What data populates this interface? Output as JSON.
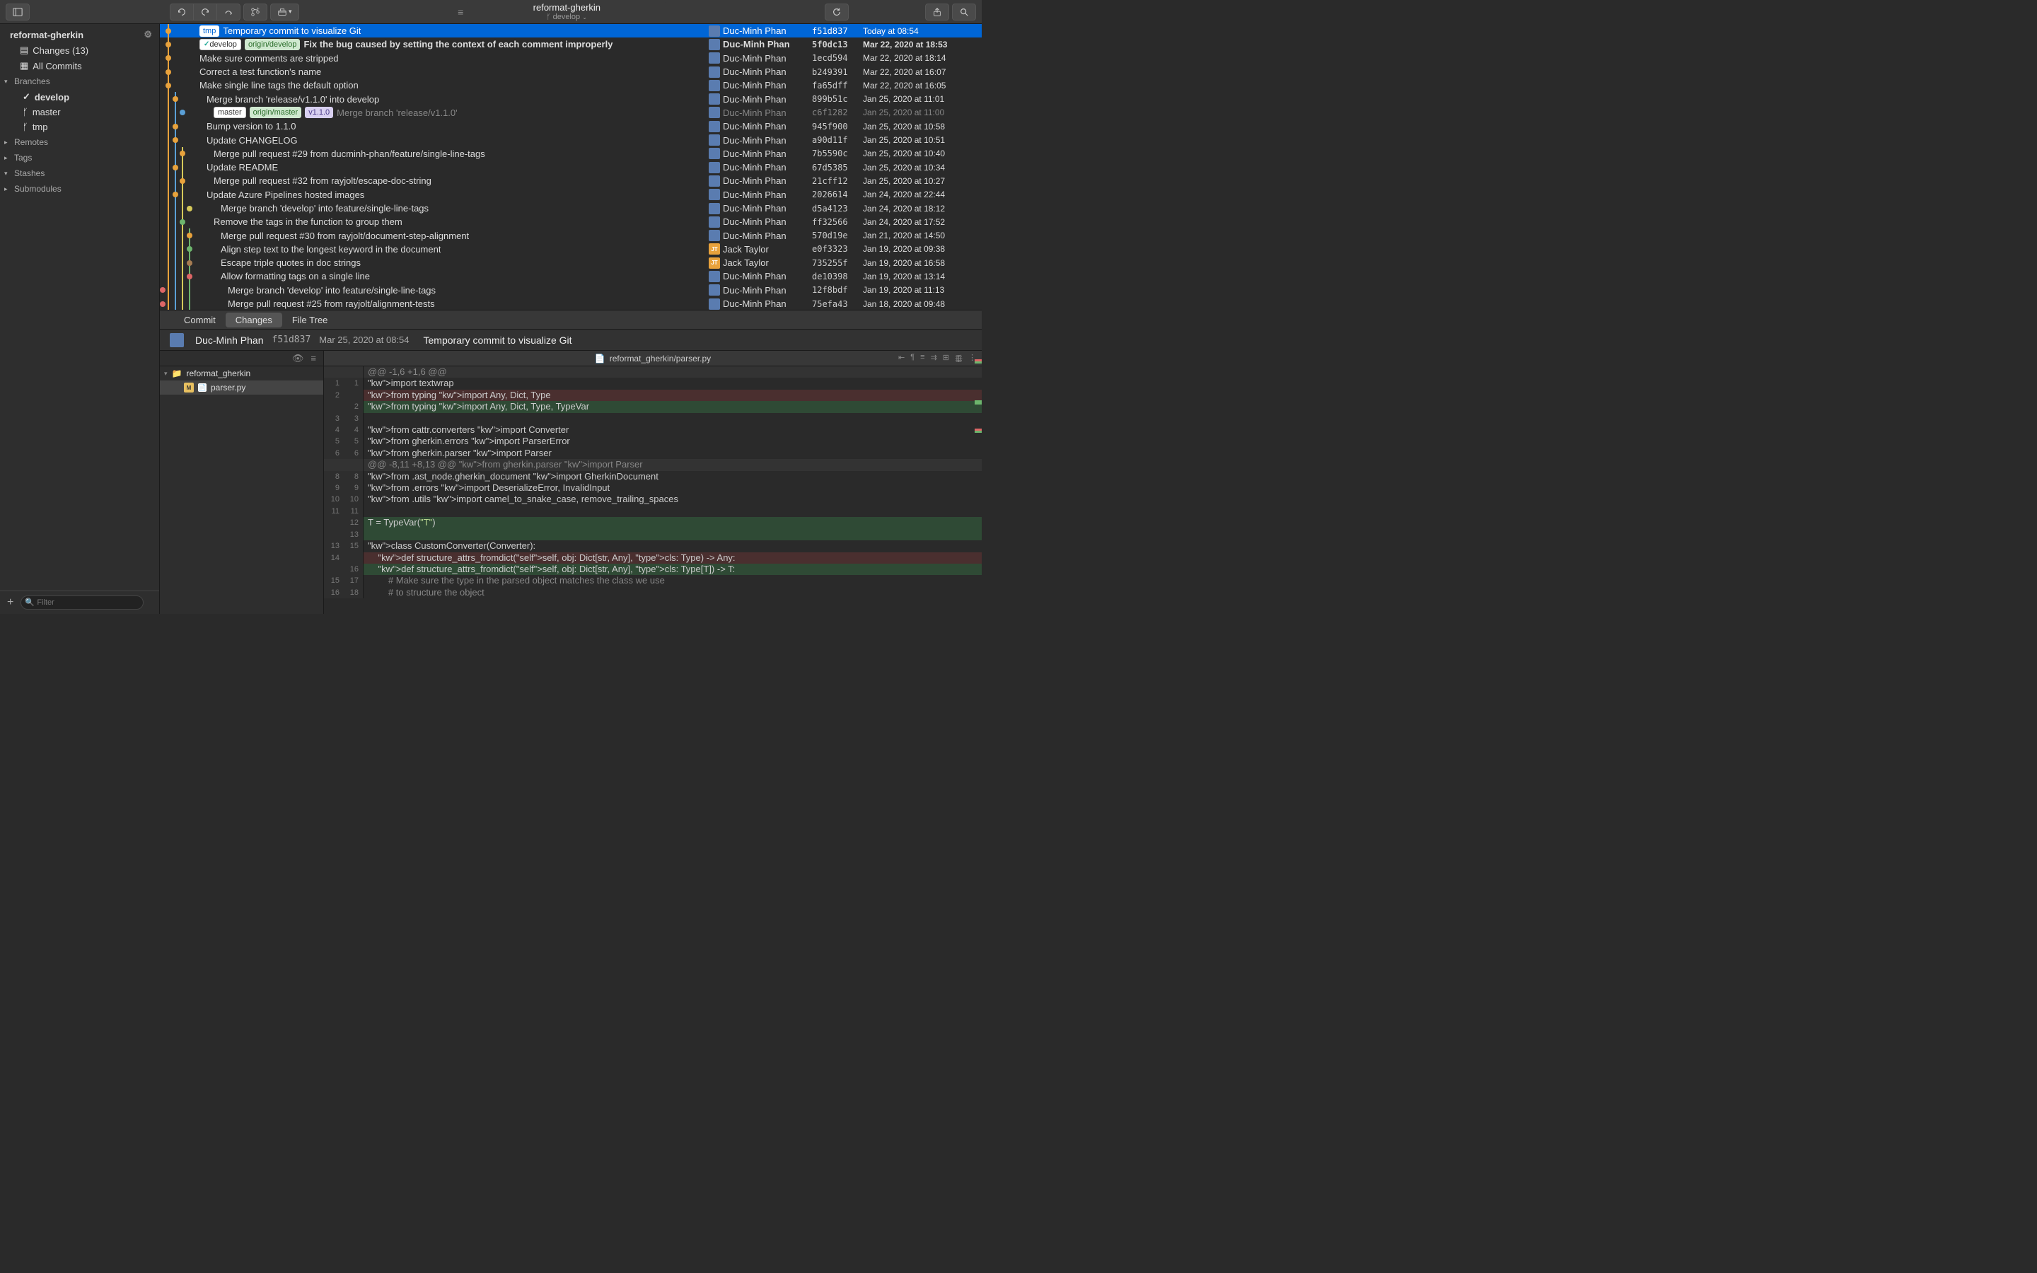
{
  "toolbar": {
    "repo_name": "reformat-gherkin",
    "branch": "develop"
  },
  "sidebar": {
    "repo": "reformat-gherkin",
    "items": [
      {
        "label": "Changes (13)",
        "icon": "changes"
      },
      {
        "label": "All Commits",
        "icon": "commits"
      }
    ],
    "sections": [
      {
        "label": "Branches",
        "expanded": true,
        "children": [
          {
            "label": "develop",
            "current": true,
            "icon": "check"
          },
          {
            "label": "master",
            "icon": "branch"
          },
          {
            "label": "tmp",
            "icon": "branch"
          }
        ]
      },
      {
        "label": "Remotes",
        "expanded": false
      },
      {
        "label": "Tags",
        "expanded": false
      },
      {
        "label": "Stashes",
        "expanded": true
      },
      {
        "label": "Submodules",
        "expanded": false
      }
    ],
    "filter_placeholder": "Filter"
  },
  "commits": [
    {
      "msg": "Temporary commit to visualize Git",
      "author": "Duc-Minh Phan",
      "hash": "f51d837",
      "date": "Today at 08:54",
      "badges": [
        {
          "t": "tmp",
          "l": "tmp"
        }
      ],
      "selected": true,
      "indent": 0
    },
    {
      "msg": "Fix the bug caused by setting the context of each comment improperly",
      "author": "Duc-Minh Phan",
      "hash": "5f0dc13",
      "date": "Mar 22, 2020 at 18:53",
      "badges": [
        {
          "t": "dev",
          "l": "develop"
        },
        {
          "t": "origin",
          "l": "origin/develop"
        }
      ],
      "bold": true,
      "indent": 0
    },
    {
      "msg": "Make sure comments are stripped",
      "author": "Duc-Minh Phan",
      "hash": "1ecd594",
      "date": "Mar 22, 2020 at 18:14",
      "indent": 0
    },
    {
      "msg": "Correct a test function's name",
      "author": "Duc-Minh Phan",
      "hash": "b249391",
      "date": "Mar 22, 2020 at 16:07",
      "indent": 0
    },
    {
      "msg": "Make single line tags the default option",
      "author": "Duc-Minh Phan",
      "hash": "fa65dff",
      "date": "Mar 22, 2020 at 16:05",
      "indent": 0
    },
    {
      "msg": "Merge branch 'release/v1.1.0' into develop",
      "author": "Duc-Minh Phan",
      "hash": "899b51c",
      "date": "Jan 25, 2020 at 11:01",
      "indent": 1
    },
    {
      "msg": "Merge branch 'release/v1.1.0'",
      "author": "Duc-Minh Phan",
      "hash": "c6f1282",
      "date": "Jan 25, 2020 at 11:00",
      "badges": [
        {
          "t": "master",
          "l": "master"
        },
        {
          "t": "origin",
          "l": "origin/master"
        },
        {
          "t": "ver",
          "l": "v1.1.0"
        }
      ],
      "dimmed": true,
      "indent": 2
    },
    {
      "msg": "Bump version to 1.1.0",
      "author": "Duc-Minh Phan",
      "hash": "945f900",
      "date": "Jan 25, 2020 at 10:58",
      "indent": 1
    },
    {
      "msg": "Update CHANGELOG",
      "author": "Duc-Minh Phan",
      "hash": "a90d11f",
      "date": "Jan 25, 2020 at 10:51",
      "indent": 1
    },
    {
      "msg": "Merge pull request #29 from ducminh-phan/feature/single-line-tags",
      "author": "Duc-Minh Phan",
      "hash": "7b5590c",
      "date": "Jan 25, 2020 at 10:40",
      "indent": 2
    },
    {
      "msg": "Update README",
      "author": "Duc-Minh Phan",
      "hash": "67d5385",
      "date": "Jan 25, 2020 at 10:34",
      "indent": 1
    },
    {
      "msg": "Merge pull request #32 from rayjolt/escape-doc-string",
      "author": "Duc-Minh Phan",
      "hash": "21cff12",
      "date": "Jan 25, 2020 at 10:27",
      "indent": 2
    },
    {
      "msg": "Update Azure Pipelines hosted images",
      "author": "Duc-Minh Phan",
      "hash": "2026614",
      "date": "Jan 24, 2020 at 22:44",
      "indent": 1
    },
    {
      "msg": "Merge branch 'develop' into feature/single-line-tags",
      "author": "Duc-Minh Phan",
      "hash": "d5a4123",
      "date": "Jan 24, 2020 at 18:12",
      "indent": 3
    },
    {
      "msg": "Remove the tags in the function to group them",
      "author": "Duc-Minh Phan",
      "hash": "ff32566",
      "date": "Jan 24, 2020 at 17:52",
      "indent": 2
    },
    {
      "msg": "Merge pull request #30 from rayjolt/document-step-alignment",
      "author": "Duc-Minh Phan",
      "hash": "570d19e",
      "date": "Jan 21, 2020 at 14:50",
      "indent": 3
    },
    {
      "msg": "Align step text to the longest keyword in the document",
      "author": "Jack Taylor",
      "hash": "e0f3323",
      "date": "Jan 19, 2020 at 09:38",
      "jt": true,
      "indent": 3
    },
    {
      "msg": "Escape triple quotes in doc strings",
      "author": "Jack Taylor",
      "hash": "735255f",
      "date": "Jan 19, 2020 at 16:58",
      "jt": true,
      "indent": 3
    },
    {
      "msg": "Allow formatting tags on a single line",
      "author": "Duc-Minh Phan",
      "hash": "de10398",
      "date": "Jan 19, 2020 at 13:14",
      "indent": 3
    },
    {
      "msg": "Merge branch 'develop' into feature/single-line-tags",
      "author": "Duc-Minh Phan",
      "hash": "12f8bdf",
      "date": "Jan 19, 2020 at 11:13",
      "indent": 4
    },
    {
      "msg": "Merge pull request #25 from rayjolt/alignment-tests",
      "author": "Duc-Minh Phan",
      "hash": "75efa43",
      "date": "Jan 18, 2020 at 09:48",
      "indent": 4
    }
  ],
  "tabs": {
    "commit": "Commit",
    "changes": "Changes",
    "filetree": "File Tree"
  },
  "commit_header": {
    "author": "Duc-Minh Phan",
    "hash": "f51d837",
    "date": "Mar 25, 2020 at 08:54",
    "msg": "Temporary commit to visualize Git"
  },
  "file_tree": {
    "folder": "reformat_gherkin",
    "files": [
      "parser.py"
    ]
  },
  "diff": {
    "file_path": "reformat_gherkin/parser.py",
    "lines": [
      {
        "t": "hunk",
        "a": "",
        "b": "",
        "code": "@@ -1,6 +1,6 @@"
      },
      {
        "t": "ctx",
        "a": "1",
        "b": "1",
        "code": "import textwrap",
        "hl": [
          [
            "kw",
            "import"
          ]
        ]
      },
      {
        "t": "del",
        "a": "2",
        "b": "",
        "code": "from typing import Any, Dict, Type",
        "hl": [
          [
            "kw",
            "from"
          ],
          [
            "kw2",
            "import"
          ]
        ]
      },
      {
        "t": "add",
        "a": "",
        "b": "2",
        "code": "from typing import Any, Dict, Type, TypeVar",
        "hl": [
          [
            "kw",
            "from"
          ],
          [
            "kw2",
            "import"
          ]
        ]
      },
      {
        "t": "ctx",
        "a": "3",
        "b": "3",
        "code": ""
      },
      {
        "t": "ctx",
        "a": "4",
        "b": "4",
        "code": "from cattr.converters import Converter",
        "hl": [
          [
            "kw",
            "from"
          ],
          [
            "kw2",
            "import"
          ]
        ]
      },
      {
        "t": "ctx",
        "a": "5",
        "b": "5",
        "code": "from gherkin.errors import ParserError",
        "hl": [
          [
            "kw",
            "from"
          ],
          [
            "kw2",
            "import"
          ]
        ]
      },
      {
        "t": "ctx",
        "a": "6",
        "b": "6",
        "code": "from gherkin.parser import Parser",
        "hl": [
          [
            "kw",
            "from"
          ],
          [
            "kw2",
            "import"
          ]
        ]
      },
      {
        "t": "hunk",
        "a": "",
        "b": "",
        "code": "@@ -8,11 +8,13 @@ from gherkin.parser import Parser"
      },
      {
        "t": "ctx",
        "a": "8",
        "b": "8",
        "code": "from .ast_node.gherkin_document import GherkinDocument",
        "hl": [
          [
            "kw",
            "from"
          ],
          [
            "kw2",
            "import"
          ]
        ]
      },
      {
        "t": "ctx",
        "a": "9",
        "b": "9",
        "code": "from .errors import DeserializeError, InvalidInput",
        "hl": [
          [
            "kw",
            "from"
          ],
          [
            "kw2",
            "import"
          ]
        ]
      },
      {
        "t": "ctx",
        "a": "10",
        "b": "10",
        "code": "from .utils import camel_to_snake_case, remove_trailing_spaces",
        "hl": [
          [
            "kw",
            "from"
          ],
          [
            "kw2",
            "import"
          ]
        ]
      },
      {
        "t": "ctx",
        "a": "11",
        "b": "11",
        "code": ""
      },
      {
        "t": "add",
        "a": "",
        "b": "12",
        "code": "T = TypeVar(\"T\")",
        "hl": [
          [
            "str",
            "\"T\""
          ]
        ]
      },
      {
        "t": "add",
        "a": "",
        "b": "13",
        "code": ""
      },
      {
        "t": "ctx",
        "a": "13",
        "b": "15",
        "code": "class CustomConverter(Converter):",
        "hl": [
          [
            "kw",
            "class"
          ]
        ]
      },
      {
        "t": "del",
        "a": "14",
        "b": "",
        "code": "    def structure_attrs_fromdict(self, obj: Dict[str, Any], cls: Type) -> Any:",
        "hl": [
          [
            "kw",
            "def"
          ],
          [
            "self",
            "self"
          ],
          [
            "type",
            "cls"
          ]
        ]
      },
      {
        "t": "add",
        "a": "",
        "b": "16",
        "code": "    def structure_attrs_fromdict(self, obj: Dict[str, Any], cls: Type[T]) -> T:",
        "hl": [
          [
            "kw",
            "def"
          ],
          [
            "self",
            "self"
          ],
          [
            "type",
            "cls"
          ]
        ]
      },
      {
        "t": "ctx",
        "a": "15",
        "b": "17",
        "code": "        # Make sure the type in the parsed object matches the class we use",
        "hl": [
          [
            "cmt",
            "# Make sure the type in the parsed object matches the class we use"
          ]
        ]
      },
      {
        "t": "ctx",
        "a": "16",
        "b": "18",
        "code": "        # to structure the object",
        "hl": [
          [
            "cmt",
            "# to structure the object"
          ]
        ]
      }
    ]
  }
}
